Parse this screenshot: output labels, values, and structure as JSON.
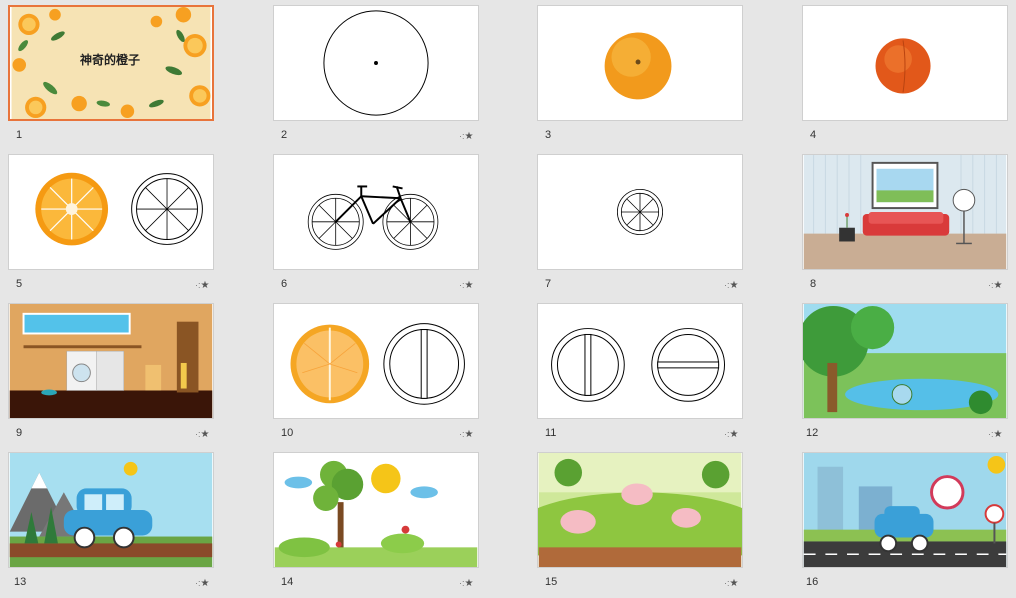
{
  "slides": [
    {
      "number": "1",
      "title": "神奇的橙子",
      "selected": true,
      "has_anim": false
    },
    {
      "number": "2",
      "has_anim": true
    },
    {
      "number": "3",
      "has_anim": false
    },
    {
      "number": "4",
      "has_anim": false
    },
    {
      "number": "5",
      "has_anim": true
    },
    {
      "number": "6",
      "has_anim": true
    },
    {
      "number": "7",
      "has_anim": true
    },
    {
      "number": "8",
      "has_anim": true
    },
    {
      "number": "9",
      "has_anim": true
    },
    {
      "number": "10",
      "has_anim": true
    },
    {
      "number": "11",
      "has_anim": true
    },
    {
      "number": "12",
      "has_anim": true
    },
    {
      "number": "13",
      "has_anim": true
    },
    {
      "number": "14",
      "has_anim": true
    },
    {
      "number": "15",
      "has_anim": true
    },
    {
      "number": "16",
      "has_anim": false
    }
  ],
  "animation_icon": "star-icon",
  "colors": {
    "selected_border": "#e8743b",
    "orange": "#f7a021",
    "background": "#e6e6e6"
  }
}
